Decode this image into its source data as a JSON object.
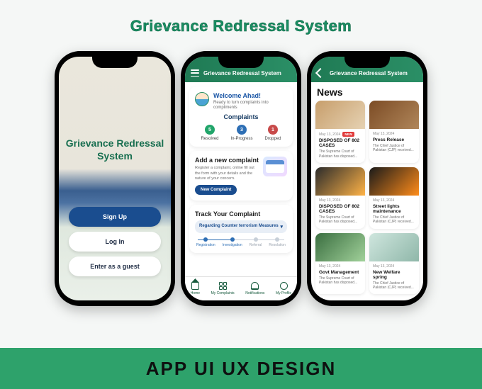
{
  "headline": "Grievance Redressal System",
  "banner": "APP UI UX DESIGN",
  "phone1": {
    "app_title": "Grievance Redressal\nSystem",
    "signup": "Sign Up",
    "login": "Log In",
    "guest": "Enter as a guest"
  },
  "phone2": {
    "topbar_title": "Grievance Redressal System",
    "welcome_name": "Welcome Ahad!",
    "welcome_sub": "Ready to turn complaints into compliments",
    "complaints_heading": "Complaints",
    "stats": [
      {
        "num": "5",
        "label": "Resolved"
      },
      {
        "num": "3",
        "label": "In-Progress"
      },
      {
        "num": "1",
        "label": "Dropped"
      }
    ],
    "add_heading": "Add a new complaint",
    "add_desc": "Register a complaint, online fill out the form with your details and the nature of your concern.",
    "add_button": "New Complaint",
    "track_heading": "Track Your Complaint",
    "track_selected": "Regarding Counter terrorism Measures",
    "track_steps": [
      "Registration",
      "Investigation",
      "Referral",
      "Resolution"
    ],
    "nav": [
      "Home",
      "My Complaints",
      "Notifications",
      "My Profile"
    ]
  },
  "phone3": {
    "topbar_title": "Grievance Redressal System",
    "heading": "News",
    "items": [
      {
        "date": "May 13, 2024",
        "badge": "NEW",
        "title": "DISPOSED OF 802 CASES",
        "excerpt": "The Supreme Court of Pakistan has disposed..."
      },
      {
        "date": "May 13, 2024",
        "badge": "",
        "title": "Press Release",
        "excerpt": "The Chief Justice of Pakistan (CJP) received..."
      },
      {
        "date": "May 13, 2024",
        "badge": "",
        "title": "DISPOSED OF 802 CASES",
        "excerpt": "The Supreme Court of Pakistan has disposed..."
      },
      {
        "date": "May 13, 2024",
        "badge": "",
        "title": "Street lights maintenance",
        "excerpt": "The Chief Justice of Pakistan (CJP) received..."
      },
      {
        "date": "May 13, 2024",
        "badge": "",
        "title": "Govt Management",
        "excerpt": "The Supreme Court of Pakistan has disposed..."
      },
      {
        "date": "May 13, 2024",
        "badge": "",
        "title": "New Welfare spring",
        "excerpt": "The Chief Justice of Pakistan (CJP) received..."
      }
    ]
  }
}
